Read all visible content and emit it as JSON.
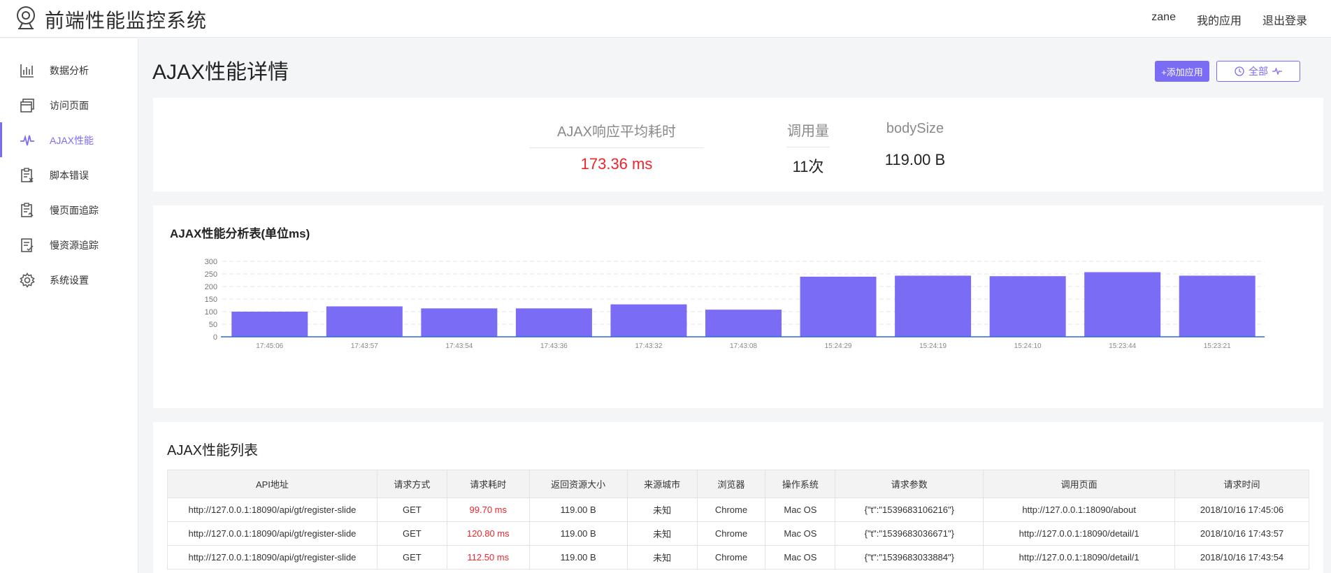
{
  "app": {
    "title": "前端性能监控系统"
  },
  "topnav": {
    "user": "zane",
    "my_apps": "我的应用",
    "logout": "退出登录"
  },
  "sidebar": {
    "items": [
      {
        "label": "数据分析",
        "icon": "bar-chart-icon",
        "active": false
      },
      {
        "label": "访问页面",
        "icon": "pages-icon",
        "active": false
      },
      {
        "label": "AJAX性能",
        "icon": "pulse-icon",
        "active": true
      },
      {
        "label": "脚本错误",
        "icon": "script-error-icon",
        "active": false
      },
      {
        "label": "慢页面追踪",
        "icon": "slow-page-icon",
        "active": false
      },
      {
        "label": "慢资源追踪",
        "icon": "slow-resource-icon",
        "active": false
      },
      {
        "label": "系统设置",
        "icon": "gear-icon",
        "active": false
      }
    ]
  },
  "page": {
    "title": "AJAX性能详情",
    "add_button": "+添加应用",
    "filter_button": "全部"
  },
  "stats": {
    "avg_label": "AJAX响应平均耗时",
    "avg_value": "173.36 ms",
    "count_label": "调用量",
    "count_value": "11次",
    "body_label": "bodySize",
    "body_value": "119.00 B"
  },
  "colors": {
    "accent": "#7b6cf6",
    "danger": "#f0242b",
    "axis": "#2f6bd6"
  },
  "chart_data": {
    "type": "bar",
    "title": "AJAX性能分析表(单位ms)",
    "categories": [
      "17:45:06",
      "17:43:57",
      "17:43:54",
      "17:43:36",
      "17:43:32",
      "17:43:08",
      "15:24:29",
      "15:24:19",
      "15:24:10",
      "15:23:44",
      "15:23:21"
    ],
    "values": [
      100,
      121,
      113,
      113,
      129,
      108,
      239,
      243,
      241,
      257,
      243
    ],
    "ylim": [
      0,
      300
    ],
    "yticks": [
      0,
      50,
      100,
      150,
      200,
      250,
      300
    ],
    "grid": true
  },
  "table": {
    "title": "AJAX性能列表",
    "headers": [
      "API地址",
      "请求方式",
      "请求耗时",
      "返回资源大小",
      "来源城市",
      "浏览器",
      "操作系统",
      "请求参数",
      "调用页面",
      "请求时间"
    ],
    "rows": [
      [
        "http://127.0.0.1:18090/api/gt/register-slide",
        "GET",
        "99.70 ms",
        "119.00 B",
        "未知",
        "Chrome",
        "Mac OS",
        "{\"t\":\"1539683106216\"}",
        "http://127.0.0.1:18090/about",
        "2018/10/16 17:45:06"
      ],
      [
        "http://127.0.0.1:18090/api/gt/register-slide",
        "GET",
        "120.80 ms",
        "119.00 B",
        "未知",
        "Chrome",
        "Mac OS",
        "{\"t\":\"1539683036671\"}",
        "http://127.0.0.1:18090/detail/1",
        "2018/10/16 17:43:57"
      ],
      [
        "http://127.0.0.1:18090/api/gt/register-slide",
        "GET",
        "112.50 ms",
        "119.00 B",
        "未知",
        "Chrome",
        "Mac OS",
        "{\"t\":\"1539683033884\"}",
        "http://127.0.0.1:18090/detail/1",
        "2018/10/16 17:43:54"
      ]
    ]
  }
}
